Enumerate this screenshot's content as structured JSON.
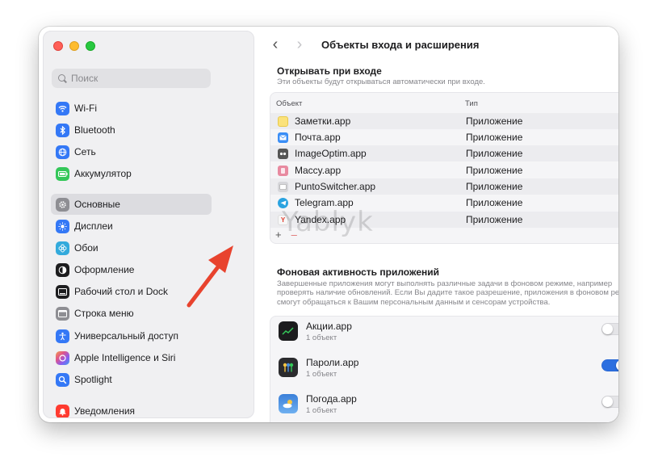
{
  "window": {
    "title": "Объекты входа и расширения"
  },
  "sidebar": {
    "search_placeholder": "Поиск",
    "items": [
      {
        "label": "Wi-Fi",
        "icon": "wifi-icon",
        "color": "#3478f6"
      },
      {
        "label": "Bluetooth",
        "icon": "bluetooth-icon",
        "color": "#3478f6"
      },
      {
        "label": "Сеть",
        "icon": "globe-icon",
        "color": "#3478f6"
      },
      {
        "label": "Аккумулятор",
        "icon": "battery-icon",
        "color": "#34c759"
      },
      {
        "label": "Основные",
        "icon": "gear-icon",
        "color": "#8e8e93",
        "active": true
      },
      {
        "label": "Дисплеи",
        "icon": "sun-icon",
        "color": "#3478f6"
      },
      {
        "label": "Обои",
        "icon": "flower-icon",
        "color": "#33aadc"
      },
      {
        "label": "Оформление",
        "icon": "appearance-icon",
        "color": "#1d1d1f"
      },
      {
        "label": "Рабочий стол и Dock",
        "icon": "dock-icon",
        "color": "#1d1d1f"
      },
      {
        "label": "Строка меню",
        "icon": "menubar-icon",
        "color": "#8e8e93"
      },
      {
        "label": "Универсальный доступ",
        "icon": "accessibility-icon",
        "color": "#3478f6"
      },
      {
        "label": "Apple Intelligence и Siri",
        "icon": "siri-icon",
        "color": "#e0568a"
      },
      {
        "label": "Spotlight",
        "icon": "spotlight-icon",
        "color": "#3478f6"
      },
      {
        "label": "Уведомления",
        "icon": "bell-icon",
        "color": "#ff3b30"
      }
    ]
  },
  "login": {
    "title": "Открывать при входе",
    "description": "Эти объекты будут открываться автоматически при входе.",
    "columns": {
      "object": "Объект",
      "type": "Тип"
    },
    "rows": [
      {
        "name": "Заметки.app",
        "type": "Приложение",
        "icon": "notes-icon",
        "color": "#f7d54a"
      },
      {
        "name": "Почта.app",
        "type": "Приложение",
        "icon": "mail-icon",
        "color": "#3a8ef6"
      },
      {
        "name": "ImageOptim.app",
        "type": "Приложение",
        "icon": "imageoptim-icon",
        "color": "#555555"
      },
      {
        "name": "Maccy.app",
        "type": "Приложение",
        "icon": "maccy-icon",
        "color": "#e88aa0"
      },
      {
        "name": "PuntoSwitcher.app",
        "type": "Приложение",
        "icon": "puntoswitcher-icon",
        "color": "#c8c8cc"
      },
      {
        "name": "Telegram.app",
        "type": "Приложение",
        "icon": "telegram-icon",
        "color": "#2aa3e0"
      },
      {
        "name": "Yandex.app",
        "type": "Приложение",
        "icon": "yandex-icon",
        "color": "#f2f2f2"
      }
    ],
    "add_symbol": "+",
    "remove_symbol": "–"
  },
  "background": {
    "title": "Фоновая активность приложений",
    "description": "Завершенные приложения могут выполнять различные задачи в фоновом режиме, например проверять наличие обновлений. Если Вы дадите такое разрешение, приложения в фоновом режиме смогут обращаться к Вашим персональным данным и сенсорам устройства.",
    "apps": [
      {
        "name": "Акции.app",
        "subtitle": "1 объект",
        "icon": "stocks-icon",
        "color": "#1c1c1e",
        "enabled": false
      },
      {
        "name": "Пароли.app",
        "subtitle": "1 объект",
        "icon": "passwords-icon",
        "color": "#2b2b2e",
        "enabled": true
      },
      {
        "name": "Погода.app",
        "subtitle": "1 объект",
        "icon": "weather-icon",
        "color": "#4a90e2",
        "enabled": false
      }
    ]
  },
  "watermark": "Yablyk",
  "accent_color": "#2c6fe0",
  "annotation_arrow_color": "#e8432e"
}
